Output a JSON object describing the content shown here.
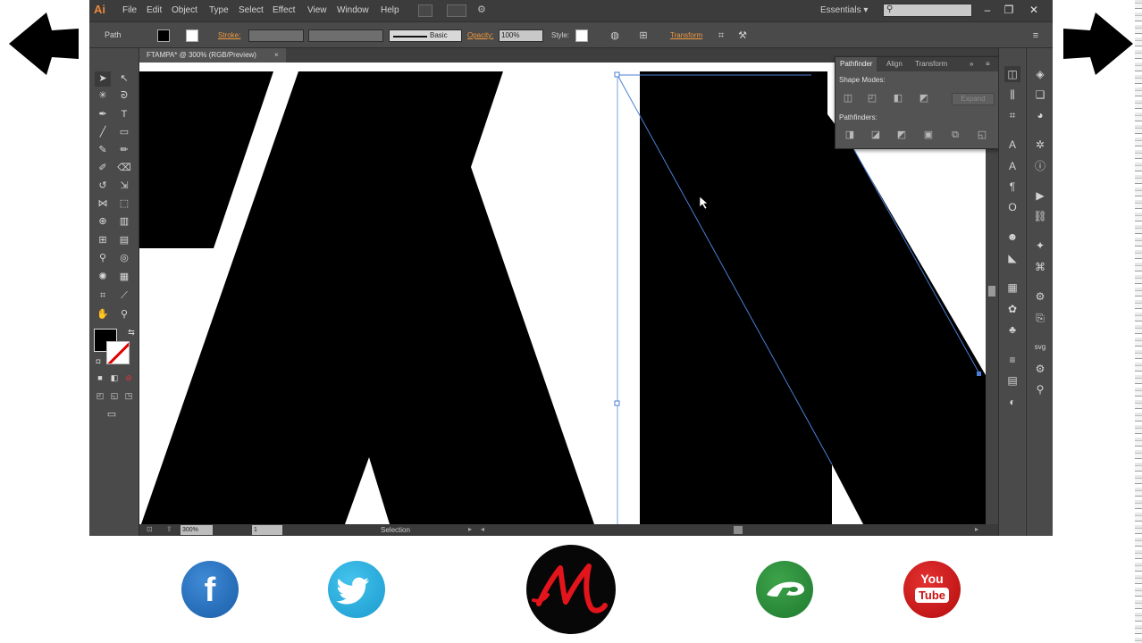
{
  "navigation": {
    "previous_icon": "arrow-left-icon",
    "next_icon": "arrow-right-icon"
  },
  "app": {
    "logo": "Ai",
    "menus": [
      "File",
      "Edit",
      "Object",
      "Type",
      "Select",
      "Effect",
      "View",
      "Window",
      "Help"
    ],
    "workspace": "Essentials"
  },
  "control_bar": {
    "selection_kind": "Path",
    "stroke_label": "Stroke:",
    "brush_label": "Basic",
    "opacity_label": "Opacity:",
    "opacity_value": "100%",
    "style_label": "Style:",
    "transform_label": "Transform"
  },
  "document": {
    "tab_title": "FTAMPA* @ 300% (RGB/Preview)",
    "zoom": "300%",
    "page": "1",
    "status_tool": "Selection"
  },
  "pathfinder_panel": {
    "tabs": [
      "Pathfinder",
      "Align",
      "Transform"
    ],
    "shape_modes_label": "Shape Modes:",
    "expand_label": "Expand",
    "pathfinders_label": "Pathfinders:"
  },
  "colors": {
    "accent": "#e8873a",
    "fill": "#000000",
    "stroke_none_mark": "#e00000",
    "selection": "#4a7fd6",
    "facebook": "#1f66b5",
    "twitter": "#2aa9e0",
    "deviantart": "#2a8c3a",
    "youtube": "#d01c1c",
    "brand_m": "#e3141c"
  },
  "social": {
    "facebook_glyph": "f",
    "youtube_top": "You",
    "youtube_bottom": "Tube"
  }
}
